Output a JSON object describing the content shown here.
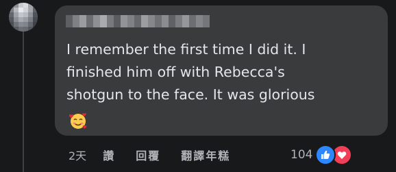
{
  "comment": {
    "author": "",
    "lines": [
      "I remember the first time I did it. I",
      "finished him off with Rebecca's",
      "shotgun to the face. It was glorious"
    ],
    "emoji": "smiling-face-with-hearts"
  },
  "actions": {
    "timestamp": "2天",
    "like_label": "讚",
    "reply_label": "回覆",
    "translate_label": "翻譯年糕"
  },
  "reactions": {
    "count": "104",
    "types": [
      "like",
      "love"
    ]
  },
  "colors": {
    "background": "#18191a",
    "bubble": "#3a3b3c",
    "text": "#e4e6eb",
    "muted": "#b0b3b8",
    "like": "#2d88ff",
    "love": "#f33e58"
  }
}
